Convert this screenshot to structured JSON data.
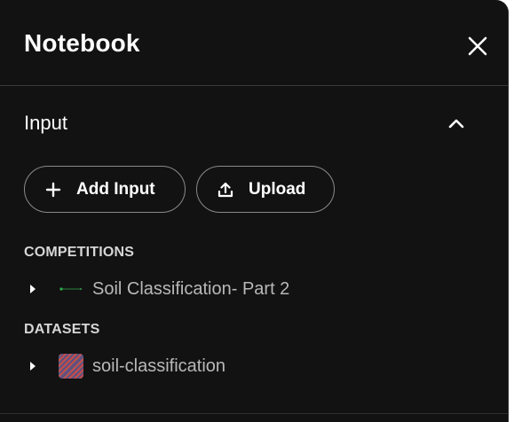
{
  "header": {
    "title": "Notebook",
    "close_icon": "close-icon"
  },
  "input_section": {
    "title": "Input",
    "collapse_icon": "chevron-up-icon",
    "buttons": {
      "add_label": "Add Input",
      "add_icon": "plus-icon",
      "upload_label": "Upload",
      "upload_icon": "upload-icon"
    }
  },
  "groups": {
    "competitions": {
      "label": "COMPETITIONS",
      "items": [
        {
          "label": "Soil Classification- Part 2",
          "icon": "competition-thumbnail"
        }
      ]
    },
    "datasets": {
      "label": "DATASETS",
      "items": [
        {
          "label": "soil-classification",
          "icon": "dataset-thumbnail"
        }
      ]
    }
  },
  "colors": {
    "panel_bg": "#121212",
    "text": "#ffffff",
    "muted_text": "#b8b8b8",
    "border": "#8a8a8a"
  }
}
